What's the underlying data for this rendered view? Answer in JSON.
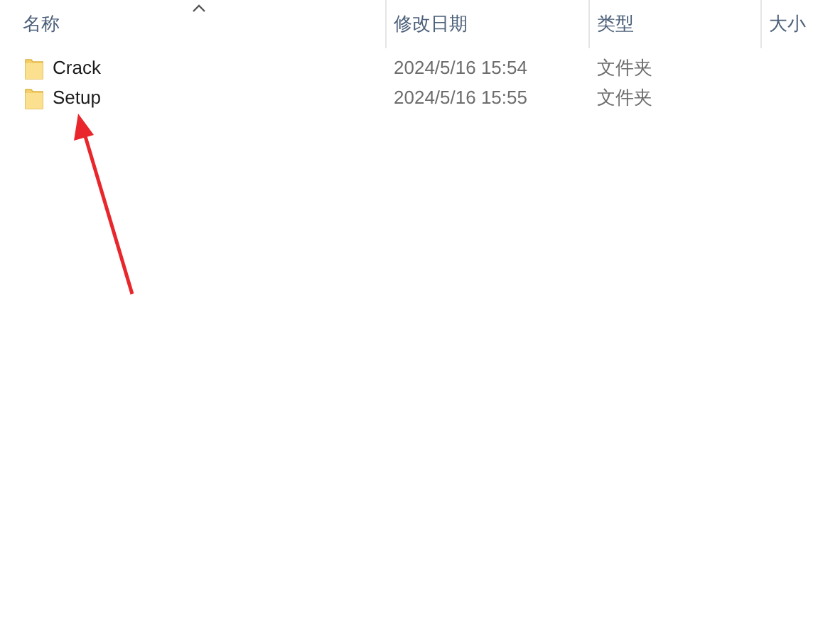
{
  "columns": [
    {
      "label": "名称",
      "sorted": true
    },
    {
      "label": "修改日期",
      "sorted": false
    },
    {
      "label": "类型",
      "sorted": false
    },
    {
      "label": "大小",
      "sorted": false
    }
  ],
  "rows": [
    {
      "name": "Crack",
      "modified": "2024/5/16 15:54",
      "type": "文件夹"
    },
    {
      "name": "Setup",
      "modified": "2024/5/16 15:55",
      "type": "文件夹"
    }
  ],
  "annotation": {
    "kind": "arrow",
    "color": "#e8262b"
  }
}
